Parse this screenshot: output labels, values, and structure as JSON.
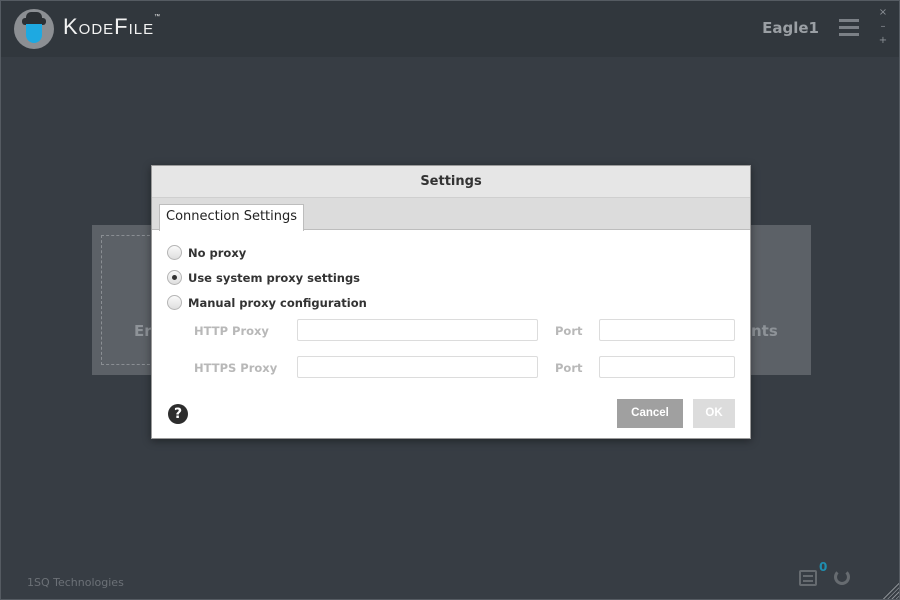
{
  "app": {
    "brand": "KodeFile",
    "tm": "™",
    "user": "Eagle1",
    "window_controls": {
      "close": "×",
      "minimize": "–",
      "maximize": "+"
    },
    "menu_icon": "hamburger-icon"
  },
  "background": {
    "fragment_left": "Er",
    "fragment_right": "nts"
  },
  "dialog": {
    "title": "Settings",
    "tab": "Connection Settings",
    "options": [
      {
        "label": "No proxy",
        "selected": false
      },
      {
        "label": "Use system proxy settings",
        "selected": true
      },
      {
        "label": "Manual proxy configuration",
        "selected": false
      }
    ],
    "http_proxy_label": "HTTP Proxy",
    "http_proxy_value": "",
    "https_proxy_label": "HTTPS Proxy",
    "https_proxy_value": "",
    "port_label": "Port",
    "http_port_value": "",
    "https_port_value": "",
    "help": "?",
    "cancel": "Cancel",
    "ok": "OK",
    "colors": {
      "cancel": "#a0a0a0",
      "ok": "#dcdcdc"
    }
  },
  "footer": {
    "company": "1SQ Technologies",
    "notification_count": "0"
  }
}
